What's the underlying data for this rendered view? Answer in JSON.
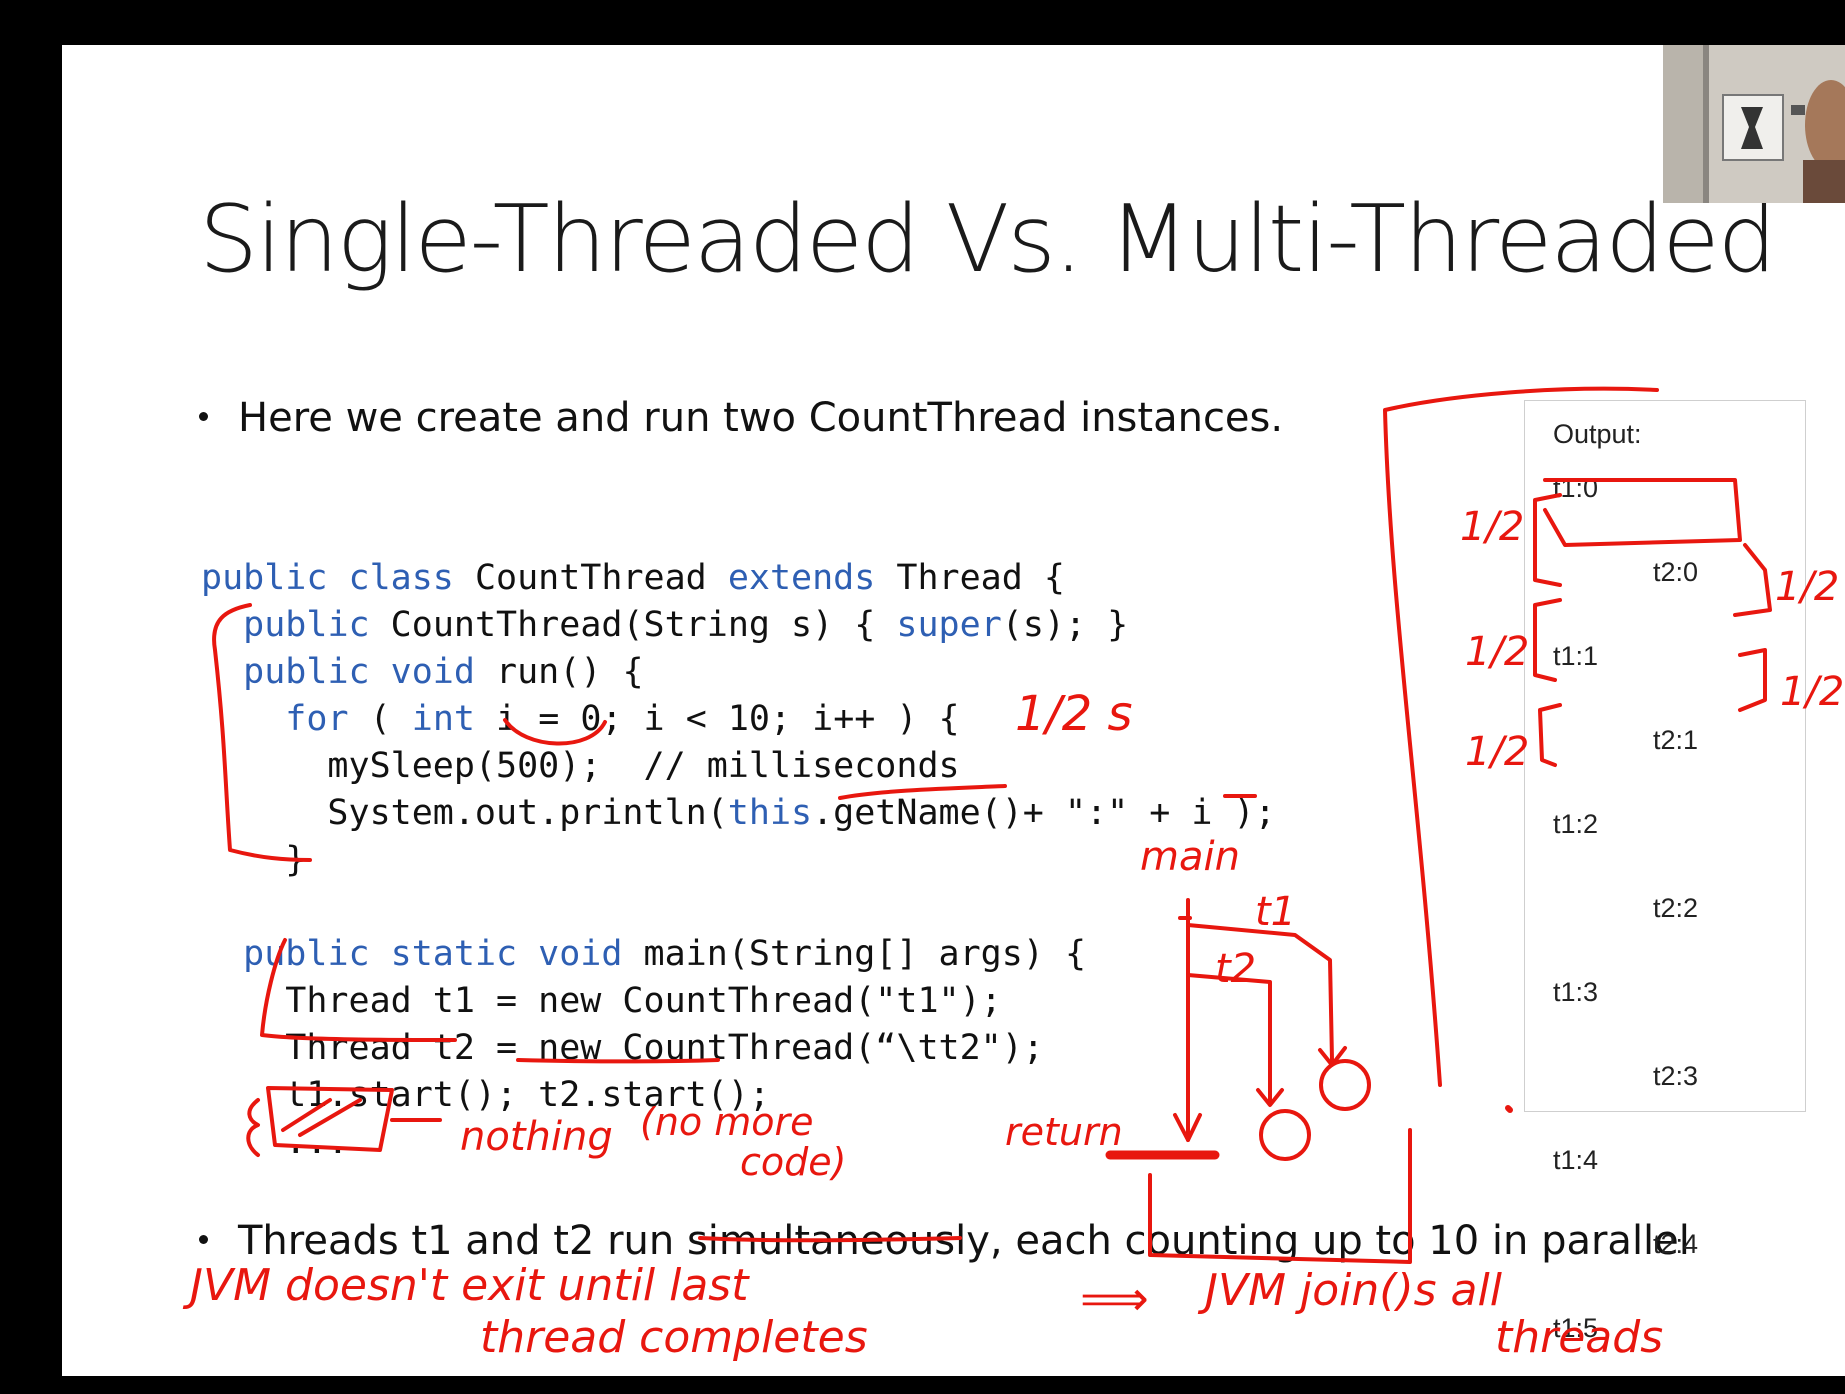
{
  "slide": {
    "title": "Single-Threaded Vs. Multi-Threaded",
    "bullet1": "Here we create and run two CountThread  instances.",
    "bullet2": "Threads t1 and t2  run simultaneously, each counting up to 10 in parallel"
  },
  "code": {
    "lines": [
      [
        [
          "kw",
          "public class "
        ],
        [
          "t",
          "CountThread "
        ],
        [
          "kw",
          "extends "
        ],
        [
          "t",
          "Thread {"
        ]
      ],
      [
        [
          "t",
          "  "
        ],
        [
          "kw",
          "public "
        ],
        [
          "t",
          "CountThread(String s) { "
        ],
        [
          "kw",
          "super"
        ],
        [
          "t",
          "(s); }"
        ]
      ],
      [
        [
          "t",
          "  "
        ],
        [
          "kw",
          "public void "
        ],
        [
          "t",
          "run() {"
        ]
      ],
      [
        [
          "t",
          "    "
        ],
        [
          "kw",
          "for "
        ],
        [
          "t",
          "( "
        ],
        [
          "kw",
          "int "
        ],
        [
          "t",
          "i = 0; i < 10; i++ ) {"
        ]
      ],
      [
        [
          "t",
          "      mySleep(500);  // milliseconds"
        ]
      ],
      [
        [
          "t",
          "      System.out.println("
        ],
        [
          "kw",
          "this"
        ],
        [
          "t",
          ".getName()+ \":\" + i );"
        ]
      ],
      [
        [
          "t",
          "    }"
        ]
      ],
      [
        [
          "t",
          ""
        ]
      ],
      [
        [
          "t",
          "  "
        ],
        [
          "kw",
          "public static void "
        ],
        [
          "t",
          "main(String[] args) {"
        ]
      ],
      [
        [
          "t",
          "    Thread t1 = new CountThread(\"t1\");"
        ]
      ],
      [
        [
          "t",
          "    Thread t2 = new CountThread(“\\tt2\");"
        ]
      ],
      [
        [
          "t",
          "    t1.start(); t2.start();"
        ]
      ],
      [
        [
          "t",
          "    ..."
        ]
      ]
    ]
  },
  "output": {
    "header": "Output:",
    "lines": [
      "t1:0",
      "t2:0",
      "t1:1",
      "t2:1",
      "t1:2",
      "t2:2",
      "t1:3",
      "t2:3",
      "t1:4",
      "t2:4",
      "t1:5",
      "..."
    ]
  },
  "annotations": {
    "half_labels": [
      "1/2",
      "1/2",
      "1/2",
      "1/2",
      "1/2",
      "1/2"
    ],
    "half_s": "1/2 s",
    "main": "main",
    "t1": "t1",
    "t2": "t2",
    "return": "return",
    "nothing": "nothing",
    "no_more": "(no more",
    "code": "code)",
    "jvm_exit_1": "JVM doesn't exit until last",
    "jvm_exit_2": "thread completes",
    "jvm_join_1": "JVM join()s all",
    "jvm_join_2": "threads"
  },
  "colors": {
    "ink": "#e8170f",
    "keyword": "#2e5fb3"
  }
}
